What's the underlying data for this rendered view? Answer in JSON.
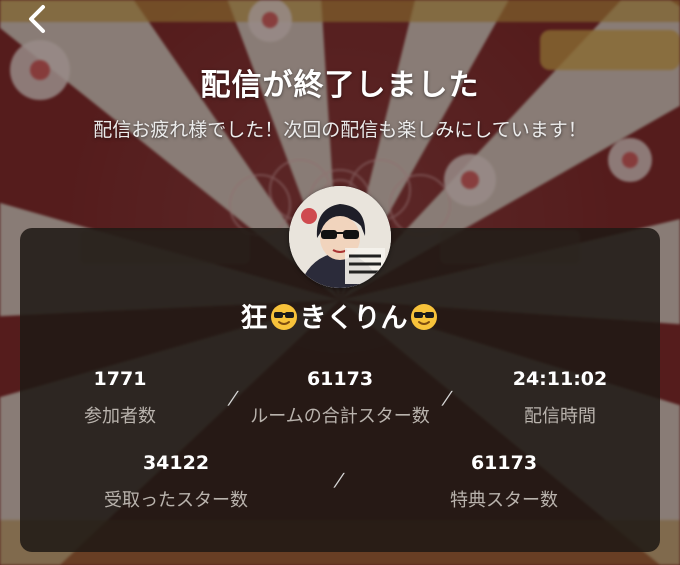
{
  "header": {
    "title": "配信が終了しました",
    "subtitle": "配信お疲れ様でした！次回の配信も楽しみにしています！"
  },
  "streamer": {
    "name_prefix": "狂",
    "name_main": "きくりん",
    "emoji": "sunglasses-face"
  },
  "stats_row1": [
    {
      "value": "1771",
      "label": "参加者数"
    },
    {
      "value": "61173",
      "label": "ルームの合計スター数"
    },
    {
      "value": "24:11:02",
      "label": "配信時間"
    }
  ],
  "stats_row2": [
    {
      "value": "34122",
      "label": "受取ったスター数"
    },
    {
      "value": "61173",
      "label": "特典スター数"
    }
  ],
  "colors": {
    "panel": "#1e1814",
    "accent_red": "#c8232c",
    "gold": "#d8b24a"
  },
  "icons": {
    "back": "chevron-left-icon"
  }
}
